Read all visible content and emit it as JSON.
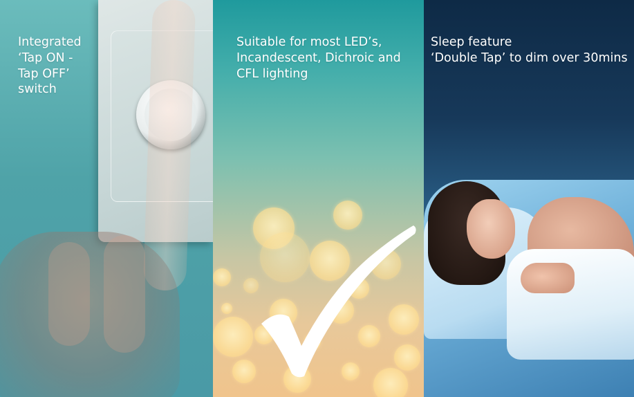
{
  "panels": [
    {
      "lines": [
        "Integrated",
        "‘Tap ON -",
        "Tap OFF’",
        "switch"
      ]
    },
    {
      "lines": [
        "Suitable for most LED’s,",
        "Incandescent, Dichroic and",
        "CFL lighting"
      ]
    },
    {
      "lines": [
        "Sleep feature",
        "‘Double Tap’ to dim over 30mins"
      ]
    }
  ],
  "colors": {
    "text": "#ffffff",
    "panel1": "#4fa3a8",
    "panel2_top": "#1f9a9d",
    "panel2_bottom": "#f0c48c",
    "panel3": "#17395a"
  }
}
